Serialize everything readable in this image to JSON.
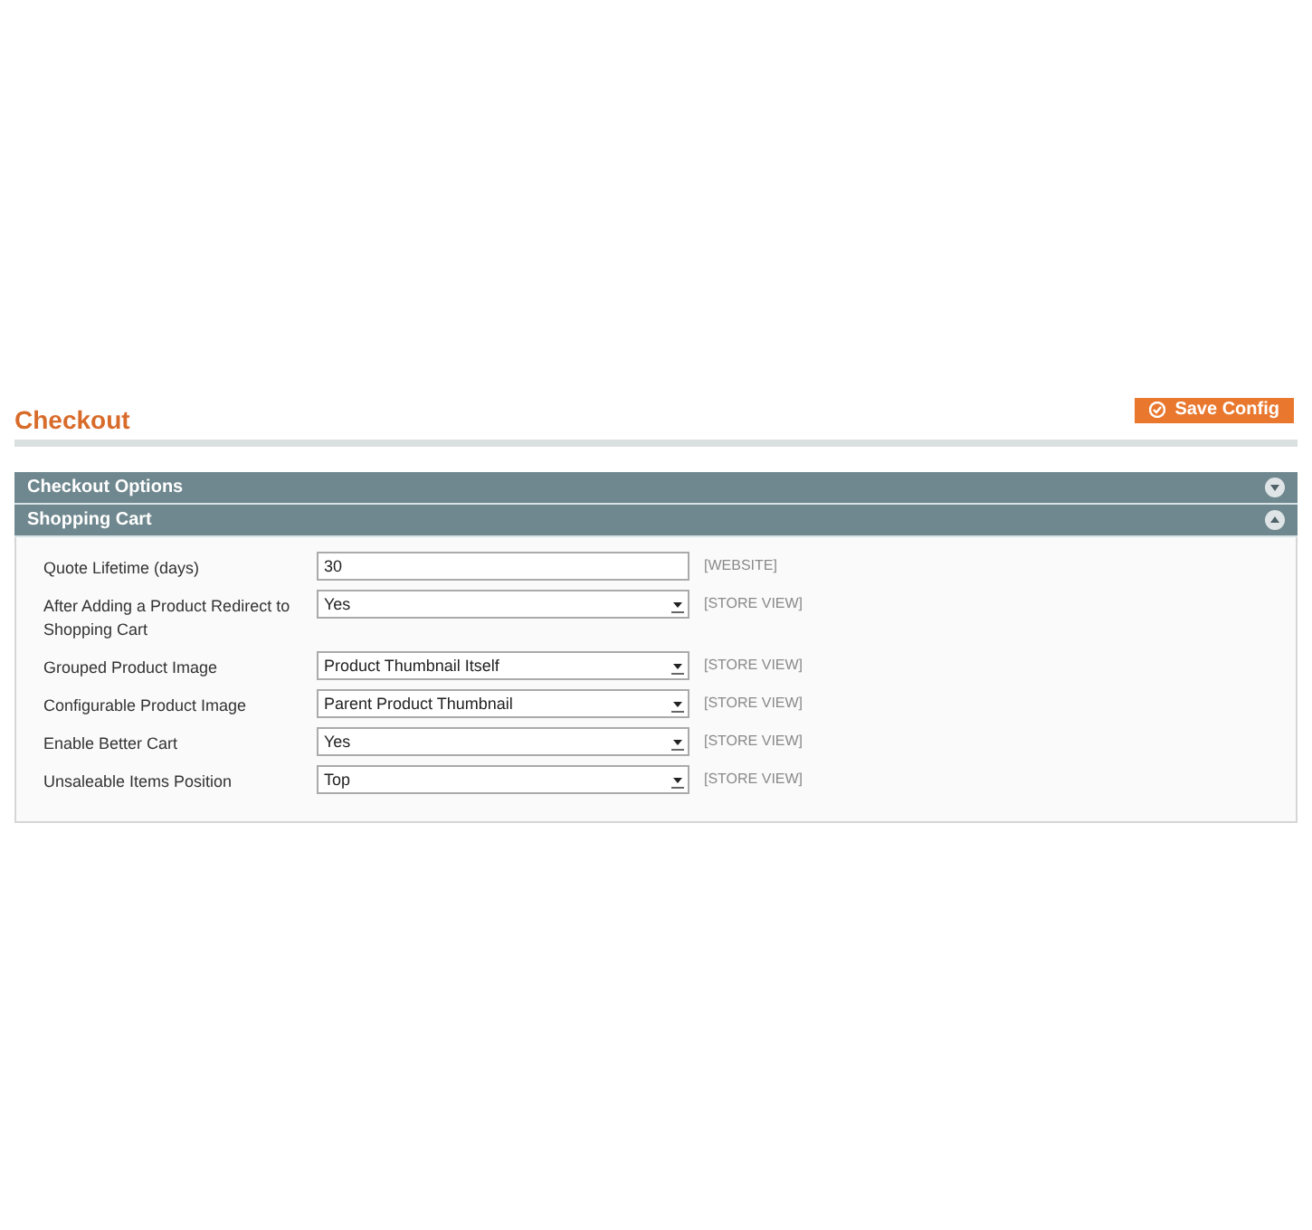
{
  "page_title": "Checkout",
  "save_button": "Save Config",
  "sections": [
    {
      "title": "Checkout Options",
      "expanded": false
    },
    {
      "title": "Shopping Cart",
      "expanded": true,
      "fields": [
        {
          "label": "Quote Lifetime (days)",
          "kind": "text",
          "value": "30",
          "scope": "[WEBSITE]"
        },
        {
          "label": "After Adding a Product Redirect to Shopping Cart",
          "kind": "select",
          "value": "Yes",
          "scope": "[STORE VIEW]"
        },
        {
          "label": "Grouped Product Image",
          "kind": "select",
          "value": "Product Thumbnail Itself",
          "scope": "[STORE VIEW]"
        },
        {
          "label": "Configurable Product Image",
          "kind": "select",
          "value": "Parent Product Thumbnail",
          "scope": "[STORE VIEW]"
        },
        {
          "label": "Enable Better Cart",
          "kind": "select",
          "value": "Yes",
          "scope": "[STORE VIEW]"
        },
        {
          "label": "Unsaleable Items Position",
          "kind": "select",
          "value": "Top",
          "scope": "[STORE VIEW]"
        }
      ]
    }
  ]
}
